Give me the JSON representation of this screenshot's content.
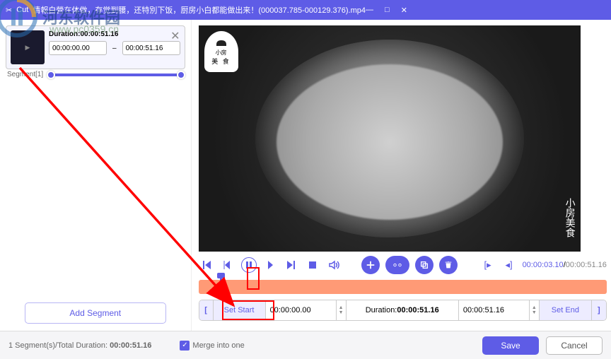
{
  "colors": {
    "accent": "#5e5ce6",
    "timeline": "#ff9a76"
  },
  "titlebar": {
    "icon_label": "Cut",
    "title": "情報白營在体做，存觉到腰，还特別下饭，厨房小白都能做出来！(000037.785-000129.376).mp4"
  },
  "segment": {
    "label": "Segment[1]",
    "duration_label": "Duration:",
    "duration_value": "00:00:51.16",
    "start": "00:00:00.00",
    "end": "00:00:51.16"
  },
  "left": {
    "add_segment": "Add Segment"
  },
  "video": {
    "logo_top": "小房",
    "logo_bottom": "美 食",
    "side": "小房美食"
  },
  "playback": {
    "current": "00:00:03.10",
    "total": "00:00:51.16"
  },
  "cut": {
    "set_start": "Set Start",
    "start_time": "00:00:00.00",
    "duration_label": "Duration:",
    "duration_value": "00:00:51.16",
    "end_time": "00:00:51.16",
    "set_end": "Set End"
  },
  "footer": {
    "summary_prefix": "1 Segment(s)/Total Duration: ",
    "summary_value": "00:00:51.16",
    "merge": "Merge into one",
    "save": "Save",
    "cancel": "Cancel"
  },
  "watermark": {
    "text1": "河东软件园",
    "text2": "www.pc0359.cn"
  }
}
